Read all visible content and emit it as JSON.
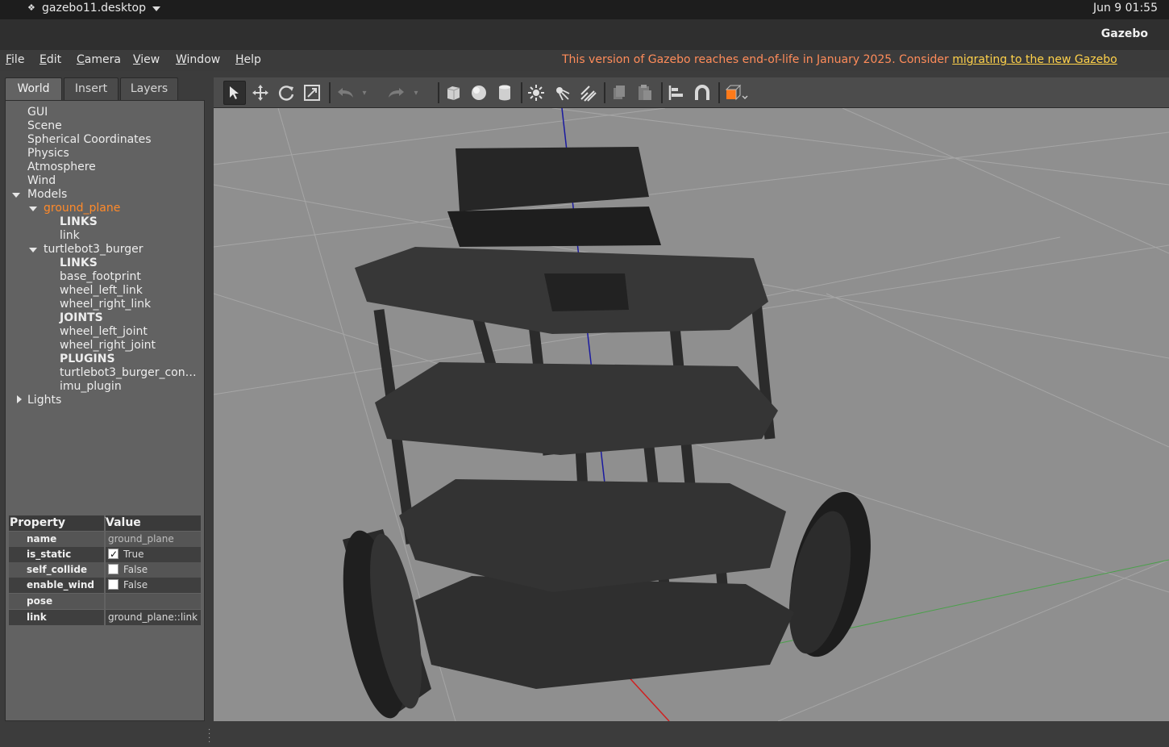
{
  "topbar": {
    "app_name": "gazebo11.desktop",
    "clock": "Jun 9  01:55"
  },
  "window": {
    "title": "Gazebo"
  },
  "menubar": {
    "menus": [
      {
        "label": "File",
        "u": "F",
        "rest": "ile"
      },
      {
        "label": "Edit",
        "u": "E",
        "rest": "dit"
      },
      {
        "label": "Camera",
        "u": "C",
        "rest": "amera"
      },
      {
        "label": "View",
        "u": "V",
        "rest": "iew"
      },
      {
        "label": "Window",
        "u": "W",
        "rest": "indow"
      },
      {
        "label": "Help",
        "u": "H",
        "rest": "elp"
      }
    ],
    "notice": "This version of Gazebo reaches end-of-life in January 2025. Consider ",
    "notice_link": "migrating to the new Gazebo"
  },
  "tabs": [
    "World",
    "Insert",
    "Layers"
  ],
  "tree": {
    "gui": "GUI",
    "scene": "Scene",
    "spherical": "Spherical Coordinates",
    "physics": "Physics",
    "atmosphere": "Atmosphere",
    "wind": "Wind",
    "models": "Models",
    "ground_plane": "ground_plane",
    "gp_links": "LINKS",
    "gp_link": "link",
    "turtlebot": "turtlebot3_burger",
    "tb_links": "LINKS",
    "base_footprint": "base_footprint",
    "wheel_left_link": "wheel_left_link",
    "wheel_right_link": "wheel_right_link",
    "tb_joints": "JOINTS",
    "wheel_left_joint": "wheel_left_joint",
    "wheel_right_joint": "wheel_right_joint",
    "tb_plugins": "PLUGINS",
    "tb_controller": "turtlebot3_burger_con…",
    "imu_plugin": "imu_plugin",
    "lights": "Lights"
  },
  "properties": {
    "header_property": "Property",
    "header_value": "Value",
    "rows": [
      {
        "key": "name",
        "value": "ground_plane"
      },
      {
        "key": "is_static",
        "value": "True"
      },
      {
        "key": "self_collide",
        "value": "False"
      },
      {
        "key": "enable_wind",
        "value": "False"
      },
      {
        "key": "pose",
        "value": ""
      },
      {
        "key": "link",
        "value": "ground_plane::link"
      }
    ]
  },
  "colors": {
    "accent": "#ff8a2a",
    "notice": "#ff8c5a",
    "link": "#ffd24a",
    "viewport": "#8f8f8f"
  }
}
